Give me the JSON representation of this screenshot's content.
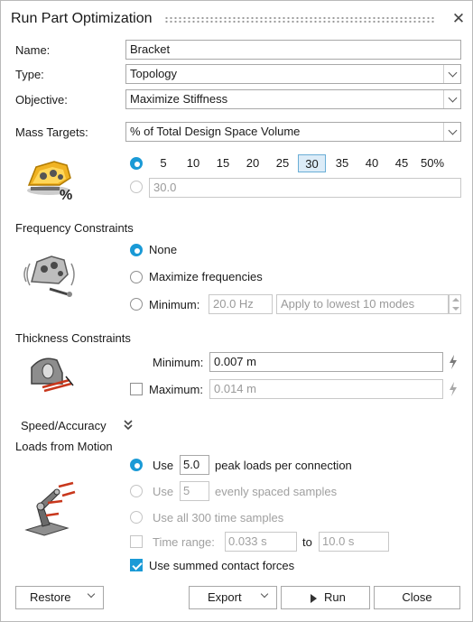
{
  "window": {
    "title": "Run Part Optimization"
  },
  "form": {
    "name_label": "Name:",
    "name_value": "Bracket",
    "type_label": "Type:",
    "type_value": "Topology",
    "objective_label": "Objective:",
    "objective_value": "Maximize Stiffness",
    "mass_targets_label": "Mass Targets:",
    "mass_targets_value": "% of Total Design Space Volume"
  },
  "mass": {
    "percent_options": [
      "5",
      "10",
      "15",
      "20",
      "25",
      "30",
      "35",
      "40",
      "45",
      "50%"
    ],
    "selected": "30",
    "custom_value": "30.0",
    "mode": "preset"
  },
  "frequency": {
    "title": "Frequency Constraints",
    "none_label": "None",
    "maximize_label": "Maximize frequencies",
    "minimum_label": "Minimum:",
    "minimum_value": "20.0 Hz",
    "modes_value": "Apply to lowest 10 modes",
    "selected": "None"
  },
  "thickness": {
    "title": "Thickness Constraints",
    "minimum_label": "Minimum:",
    "minimum_value": "0.007 m",
    "maximum_label": "Maximum:",
    "maximum_value": "0.014 m",
    "maximum_checked": false
  },
  "speed": {
    "label": "Speed/Accuracy"
  },
  "loads": {
    "title": "Loads from Motion",
    "use_label": "Use",
    "peak_value": "5.0",
    "peak_suffix": "peak loads per connection",
    "samples_value": "5",
    "samples_suffix": "evenly spaced samples",
    "all_label": "Use all 300 time samples",
    "time_range_label": "Time range:",
    "time_from": "0.033 s",
    "to_label": "to",
    "time_to": "10.0 s",
    "summed_label": "Use summed contact forces",
    "summed_checked": true,
    "selected": "peak"
  },
  "footer": {
    "restore_label": "Restore",
    "export_label": "Export",
    "run_label": "Run",
    "close_label": "Close"
  },
  "colors": {
    "accent": "#1a9ad6",
    "selected_bg": "#dcecf8",
    "disabled_text": "#a0a0a0"
  },
  "icons": [
    "close-icon",
    "chevron-down-icon",
    "mass-target-icon",
    "frequency-icon",
    "thickness-icon",
    "bolt-icon",
    "double-chevron-down-icon",
    "motion-loads-icon",
    "play-icon"
  ]
}
